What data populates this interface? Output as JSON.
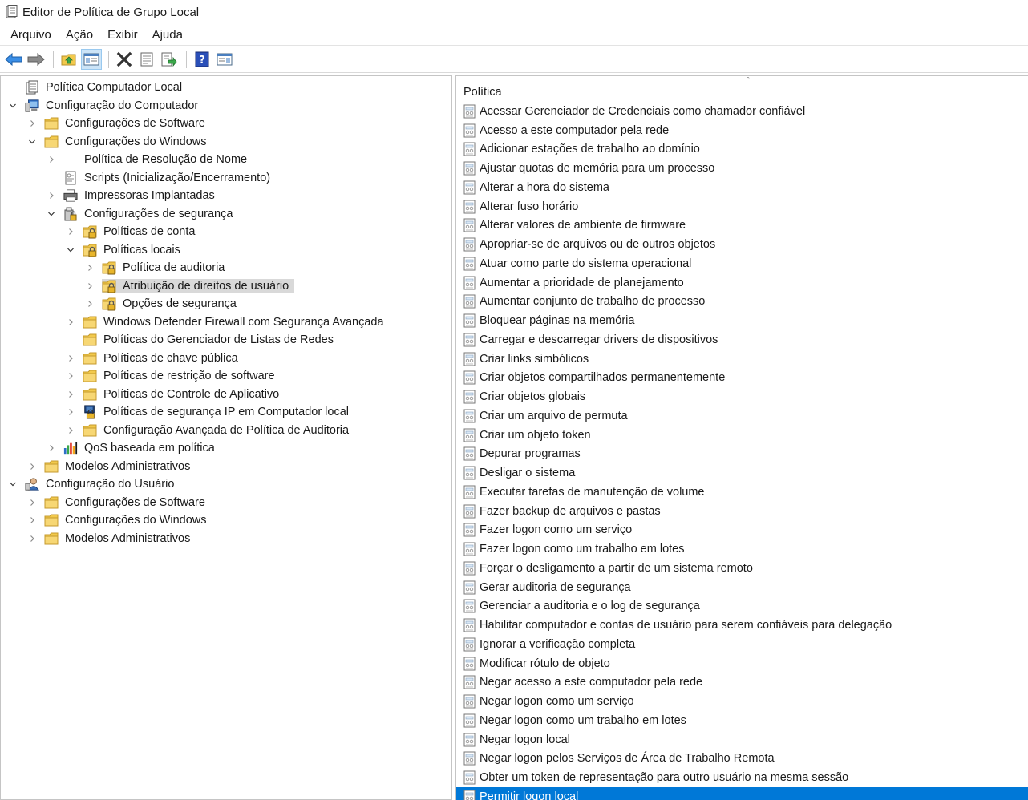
{
  "window": {
    "title": "Editor de Política de Grupo Local"
  },
  "menu": [
    "Arquivo",
    "Ação",
    "Exibir",
    "Ajuda"
  ],
  "toolbar": [
    {
      "icon": "back-arrow-icon"
    },
    {
      "icon": "forward-arrow-icon"
    },
    {
      "icon": "up-folder-icon"
    },
    {
      "icon": "show-hide-tree-icon"
    },
    {
      "icon": "delete-icon"
    },
    {
      "icon": "properties-icon"
    },
    {
      "icon": "export-list-icon"
    },
    {
      "icon": "help-icon"
    },
    {
      "icon": "action-pane-icon"
    }
  ],
  "tree": [
    {
      "label": "Política Computador Local",
      "level": 0,
      "expander": "none",
      "icon": "policy-doc-icon"
    },
    {
      "label": "Configuração do Computador",
      "level": 0,
      "expander": "expanded",
      "icon": "computer-icon"
    },
    {
      "label": "Configurações de Software",
      "level": 1,
      "expander": "collapsed",
      "icon": "folder-icon"
    },
    {
      "label": "Configurações do Windows",
      "level": 1,
      "expander": "expanded",
      "icon": "folder-icon"
    },
    {
      "label": "Política de Resolução de Nome",
      "level": 2,
      "expander": "collapsed",
      "icon": "none"
    },
    {
      "label": "Scripts (Inicialização/Encerramento)",
      "level": 2,
      "expander": "none",
      "icon": "script-icon"
    },
    {
      "label": "Impressoras Implantadas",
      "level": 2,
      "expander": "collapsed",
      "icon": "printer-icon"
    },
    {
      "label": "Configurações de segurança",
      "level": 2,
      "expander": "expanded",
      "icon": "security-settings-icon"
    },
    {
      "label": "Políticas de conta",
      "level": 3,
      "expander": "collapsed",
      "icon": "locked-folder-icon"
    },
    {
      "label": "Políticas locais",
      "level": 3,
      "expander": "expanded",
      "icon": "locked-folder-icon"
    },
    {
      "label": "Política de auditoria",
      "level": 4,
      "expander": "collapsed",
      "icon": "locked-folder-icon"
    },
    {
      "label": "Atribuição de direitos de usuário",
      "level": 4,
      "expander": "collapsed",
      "icon": "locked-folder-icon",
      "selected": true
    },
    {
      "label": "Opções de segurança",
      "level": 4,
      "expander": "collapsed",
      "icon": "locked-folder-icon"
    },
    {
      "label": "Windows Defender Firewall com Segurança Avançada",
      "level": 3,
      "expander": "collapsed",
      "icon": "folder-icon"
    },
    {
      "label": "Políticas do Gerenciador de Listas de Redes",
      "level": 3,
      "expander": "none",
      "icon": "folder-icon"
    },
    {
      "label": "Políticas de chave pública",
      "level": 3,
      "expander": "collapsed",
      "icon": "folder-icon"
    },
    {
      "label": "Políticas de restrição de software",
      "level": 3,
      "expander": "collapsed",
      "icon": "folder-icon"
    },
    {
      "label": "Políticas de Controle de Aplicativo",
      "level": 3,
      "expander": "collapsed",
      "icon": "folder-icon"
    },
    {
      "label": "Políticas de segurança IP em Computador local",
      "level": 3,
      "expander": "collapsed",
      "icon": "ip-security-icon"
    },
    {
      "label": "Configuração Avançada de Política de Auditoria",
      "level": 3,
      "expander": "collapsed",
      "icon": "folder-icon"
    },
    {
      "label": "QoS baseada em política",
      "level": 2,
      "expander": "collapsed",
      "icon": "qos-chart-icon"
    },
    {
      "label": "Modelos Administrativos",
      "level": 1,
      "expander": "collapsed",
      "icon": "folder-icon"
    },
    {
      "label": "Configuração do Usuário",
      "level": 0,
      "expander": "expanded",
      "icon": "user-icon"
    },
    {
      "label": "Configurações de Software",
      "level": 1,
      "expander": "collapsed",
      "icon": "folder-icon"
    },
    {
      "label": "Configurações do Windows",
      "level": 1,
      "expander": "collapsed",
      "icon": "folder-icon"
    },
    {
      "label": "Modelos Administrativos",
      "level": 1,
      "expander": "collapsed",
      "icon": "folder-icon"
    }
  ],
  "list": {
    "header": "Política",
    "items": [
      "Acessar Gerenciador de Credenciais como chamador confiável",
      "Acesso a este computador pela rede",
      "Adicionar estações de trabalho ao domínio",
      "Ajustar quotas de memória para um processo",
      "Alterar a hora do sistema",
      "Alterar fuso horário",
      "Alterar valores de ambiente de firmware",
      "Apropriar-se de arquivos ou de outros objetos",
      "Atuar como parte do sistema operacional",
      "Aumentar a prioridade de planejamento",
      "Aumentar conjunto de trabalho de processo",
      "Bloquear páginas na memória",
      "Carregar e descarregar drivers de dispositivos",
      "Criar links simbólicos",
      "Criar objetos compartilhados permanentemente",
      "Criar objetos globais",
      "Criar um arquivo de permuta",
      "Criar um objeto token",
      "Depurar programas",
      "Desligar o sistema",
      "Executar tarefas de manutenção de volume",
      "Fazer backup de arquivos e pastas",
      "Fazer logon como um serviço",
      "Fazer logon como um trabalho em lotes",
      "Forçar o desligamento a partir de um sistema remoto",
      "Gerar auditoria de segurança",
      "Gerenciar a auditoria e o log de segurança",
      "Habilitar computador e contas de usuário para serem confiáveis para delegação",
      "Ignorar a verificação completa",
      "Modificar rótulo de objeto",
      "Negar acesso a este computador pela rede",
      "Negar logon como um serviço",
      "Negar logon como um trabalho em lotes",
      "Negar logon local",
      "Negar logon pelos Serviços de Área de Trabalho Remota",
      "Obter um token de representação para outro usuário na mesma sessão",
      "Permitir logon local"
    ],
    "selected_index": 36
  },
  "colors": {
    "selection": "#0078d7",
    "tree_selection": "#d9d9d9",
    "folder": "#f2c94c"
  }
}
